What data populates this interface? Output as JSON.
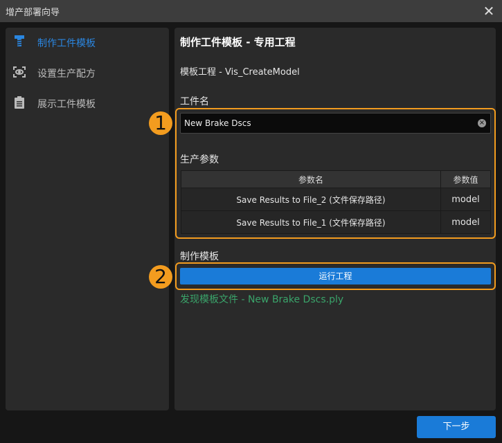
{
  "window": {
    "title": "增产部署向导",
    "close": "✕"
  },
  "sidebar": {
    "items": [
      {
        "label": "制作工件模板",
        "icon": "screw-icon"
      },
      {
        "label": "设置生产配方",
        "icon": "eye-scan-icon"
      },
      {
        "label": "展示工件模板",
        "icon": "clipboard-icon"
      }
    ]
  },
  "main": {
    "title": "制作工件模板 - 专用工程",
    "project": "模板工程 - Vis_CreateModel",
    "workpiece_label": "工件名",
    "workpiece_value": "New Brake Dscs",
    "params_label": "生产参数",
    "table": {
      "headers": [
        "参数名",
        "参数值"
      ],
      "rows": [
        [
          "Save Results to File_2 (文件保存路径)",
          "model"
        ],
        [
          "Save Results to File_1 (文件保存路径)",
          "model"
        ]
      ]
    },
    "make_label": "制作模板",
    "run_button": "运行工程",
    "found_text": "发现模板文件 - New Brake Dscs.ply"
  },
  "callouts": [
    "1",
    "2"
  ],
  "footer": {
    "next_button": "下一步"
  },
  "colors": {
    "accent": "#1a7bd8",
    "callout": "#f39c1f",
    "success": "#3aa46a"
  }
}
